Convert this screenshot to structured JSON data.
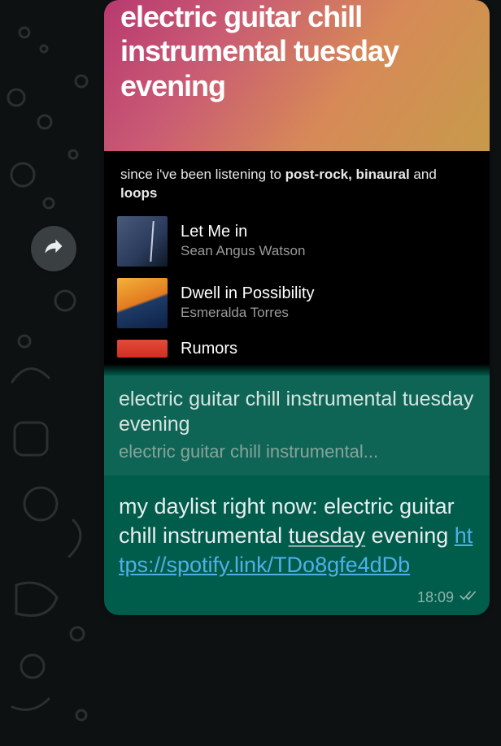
{
  "preview": {
    "hero_title": "electric guitar chill instrumental tuesday evening",
    "sub_prefix": "since i've been listening to ",
    "sub_bold": "post-rock, binaural",
    "sub_middle": " and ",
    "sub_bold2": "loops",
    "tracks": [
      {
        "title": "Let Me in",
        "artist": "Sean Angus Watson"
      },
      {
        "title": "Dwell in Possibility",
        "artist": "Esmeralda Torres"
      },
      {
        "title": "Rumors",
        "artist": ""
      }
    ]
  },
  "linkcard": {
    "title": "electric guitar chill instrumental tuesday evening",
    "subtitle": "electric guitar chill instrumental..."
  },
  "message": {
    "text_before_underline": "my daylist right now: electric guitar chill instrumental ",
    "underlined_word": "tuesday",
    "text_after_underline": " evening ",
    "link_text": "https://spotify.link/TDo8gfe4dDb",
    "link_href": "https://spotify.link/TDo8gfe4dDb"
  },
  "meta": {
    "time": "18:09"
  }
}
